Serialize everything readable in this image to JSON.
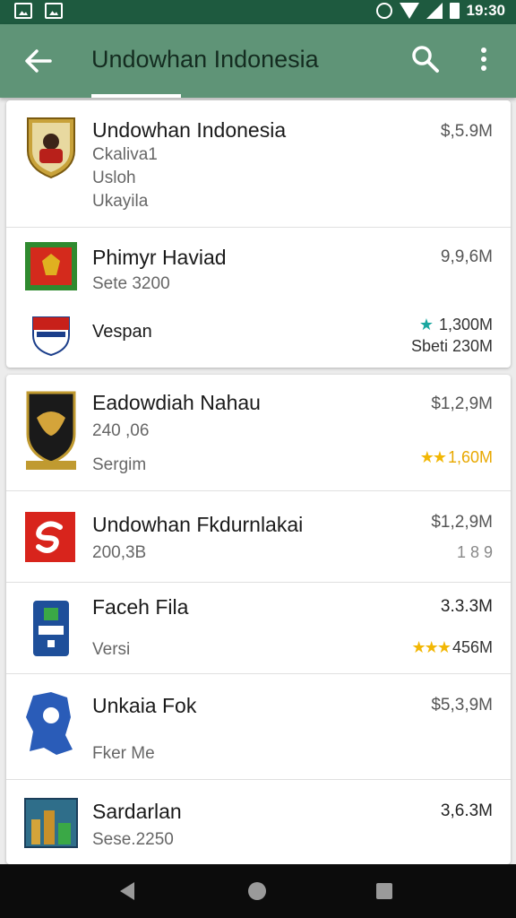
{
  "status_bar": {
    "time": "19:30",
    "icons": [
      "gallery-icon",
      "mail-icon",
      "alarm-icon",
      "wifi-icon",
      "signal-icon",
      "battery-icon"
    ]
  },
  "app_bar": {
    "title": "Undowhan Indonesia",
    "back_icon": "arrow-left-icon",
    "search_icon": "search-icon",
    "more_icon": "more-vert-icon"
  },
  "card1": {
    "row1": {
      "name": "Undowhan Indonesia",
      "sub1": "Ckaliva1",
      "sub2": "Usloh",
      "sub3": "Ukayila",
      "price": "$,5.9M"
    },
    "row2": {
      "name": "Phimyr Haviad",
      "sub": "Sete 3200",
      "price": "9,9,6M"
    },
    "row3": {
      "name": "Vespan",
      "meta1": "1,300M",
      "meta2": "Sbeti 230M"
    }
  },
  "card2": {
    "row1": {
      "name": "Eadowdiah Nahau",
      "sub1": "240 ,06",
      "sub2": "Sergim",
      "price": "$1,2,9M",
      "rating": "1,60M"
    },
    "row2": {
      "name": "Undowhan Fkdurnlakai",
      "sub": "200,3B",
      "price": "$1,2,9M",
      "meta": "1 8 9"
    },
    "row3": {
      "name": "Faceh Fila",
      "sub": "Versi",
      "price": "3.3.3M",
      "rating": "456M"
    },
    "row4": {
      "name": "Unkaia Fok",
      "sub": "Fker Me",
      "price": "$5,3,9M"
    },
    "row5": {
      "name": "Sardarlan",
      "sub": "Sese.2250",
      "price": "3,6.3M"
    }
  },
  "colors": {
    "status_bar": "#1e5a3f",
    "app_bar": "#5f9477",
    "star_gold": "#f2b705",
    "star_teal": "#1aa7a0"
  }
}
